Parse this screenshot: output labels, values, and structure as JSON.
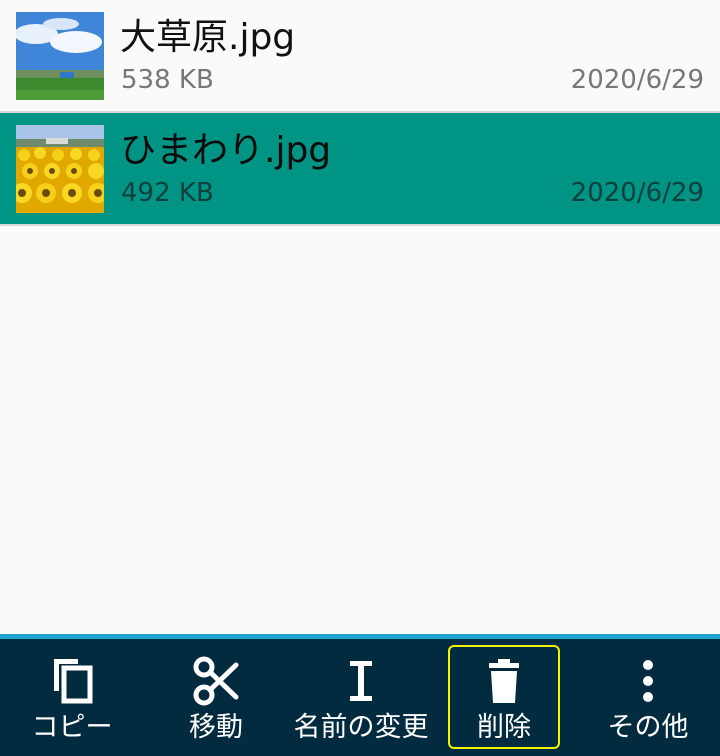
{
  "files": [
    {
      "name": "大草原.jpg",
      "size": "538 KB",
      "date": "2020/6/29",
      "selected": false,
      "thumbnail": "meadow-sky-thumbnail"
    },
    {
      "name": "ひまわり.jpg",
      "size": "492 KB",
      "date": "2020/6/29",
      "selected": true,
      "thumbnail": "sunflower-field-thumbnail"
    }
  ],
  "toolbar": {
    "copy_label": "コピー",
    "move_label": "移動",
    "rename_label": "名前の変更",
    "delete_label": "削除",
    "more_label": "その他"
  },
  "colors": {
    "selected_row": "#009485",
    "toolbar_bg": "#032b3f",
    "toolbar_accent": "#1ea4cf",
    "highlight": "#f2f200"
  }
}
